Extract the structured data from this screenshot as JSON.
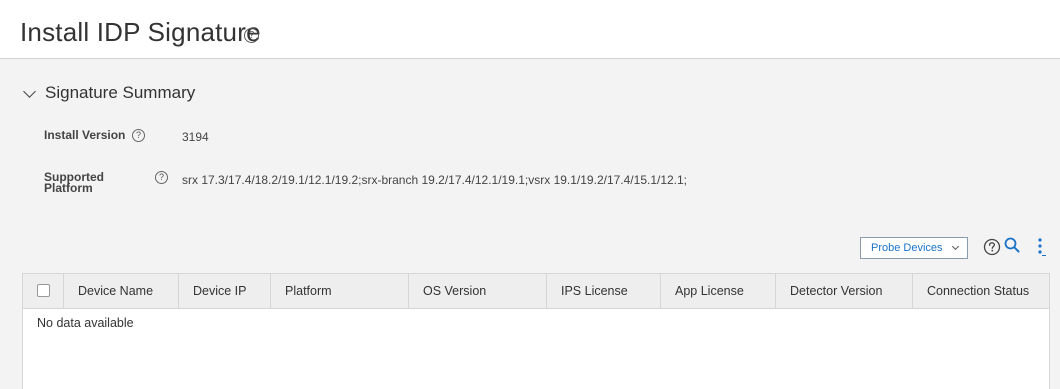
{
  "page": {
    "title": "Install IDP Signature",
    "help_glyph": "?"
  },
  "summary": {
    "section_title": "Signature Summary",
    "install_version_label": "Install Version",
    "install_version_value": "3194",
    "supported_platform_label_line1": "Supported",
    "supported_platform_label_line2": "Platform",
    "supported_platform_value": "srx 17.3/17.4/18.2/19.1/12.1/19.2;srx-branch 19.2/17.4/12.1/19.1;vsrx 19.1/19.2/17.4/15.1/12.1;"
  },
  "toolbar": {
    "probe_devices_label": "Probe Devices",
    "icons": [
      "help-icon",
      "search-icon",
      "more-vertical-icon"
    ],
    "accent_color": "#1a73c8"
  },
  "grid": {
    "columns": [
      "Device Name",
      "Device IP",
      "Platform",
      "OS Version",
      "IPS License",
      "App License",
      "Detector Version",
      "Connection Status"
    ],
    "rows": [],
    "empty_message": "No data available"
  }
}
